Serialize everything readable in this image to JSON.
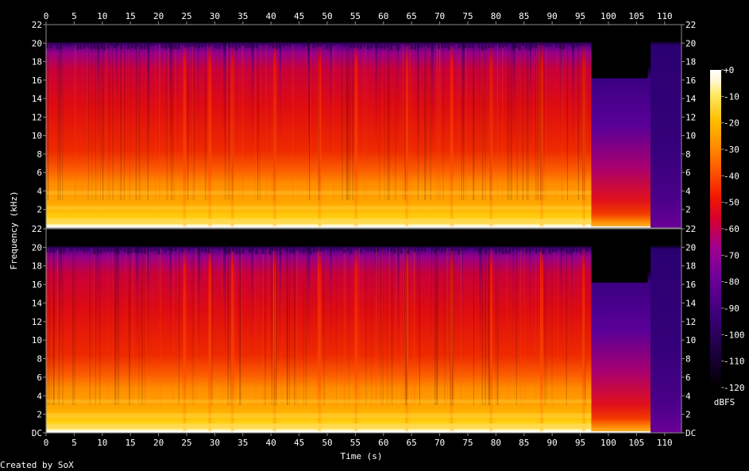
{
  "chart_data": {
    "type": "heatmap",
    "title": "",
    "xlabel": "Time (s)",
    "ylabel": "Frequency (kHz)",
    "xlim": [
      0,
      113
    ],
    "ylim": [
      0,
      22
    ],
    "x_ticks": [
      "0",
      "5",
      "10",
      "15",
      "20",
      "25",
      "30",
      "35",
      "40",
      "45",
      "50",
      "55",
      "60",
      "65",
      "70",
      "75",
      "80",
      "85",
      "90",
      "95",
      "100",
      "105",
      "110"
    ],
    "x_tick_values": [
      0,
      5,
      10,
      15,
      20,
      25,
      30,
      35,
      40,
      45,
      50,
      55,
      60,
      65,
      70,
      75,
      80,
      85,
      90,
      95,
      100,
      105,
      110
    ],
    "y_ticks_top": [
      "22",
      "20",
      "18",
      "16",
      "14",
      "12",
      "10",
      "8",
      "6",
      "4",
      "2"
    ],
    "y_ticks_bottom": [
      "22",
      "20",
      "18",
      "16",
      "14",
      "12",
      "10",
      "8",
      "6",
      "4",
      "2",
      "DC"
    ],
    "y_tick_values_top": [
      22,
      20,
      18,
      16,
      14,
      12,
      10,
      8,
      6,
      4,
      2
    ],
    "y_tick_values_bottom": [
      22,
      20,
      18,
      16,
      14,
      12,
      10,
      8,
      6,
      4,
      2,
      0
    ],
    "channels": [
      "left",
      "right"
    ],
    "music_end_s": 97,
    "cutoff_khz": 20,
    "colorbar": {
      "label": "dBFS",
      "ticks": [
        "+0",
        "-10",
        "-20",
        "-30",
        "-40",
        "-50",
        "-60",
        "-70",
        "-80",
        "-90",
        "-100",
        "-110",
        "-120"
      ],
      "tick_values": [
        0,
        -10,
        -20,
        -30,
        -40,
        -50,
        -60,
        -70,
        -80,
        -90,
        -100,
        -110,
        -120
      ],
      "range": [
        -120,
        0
      ]
    },
    "colors": {
      "background": "#000000",
      "axis": "#8c8c8c",
      "text": "#ffffff",
      "colormap": [
        "#000000",
        "#140030",
        "#33006b",
        "#5a0090",
        "#8a009c",
        "#b3007a",
        "#d8002a",
        "#f01e00",
        "#fd5a00",
        "#ff9000",
        "#ffc000",
        "#ffe85a",
        "#fffbe0",
        "#ffffff"
      ]
    }
  },
  "footer": {
    "credit": "Created by SoX"
  }
}
